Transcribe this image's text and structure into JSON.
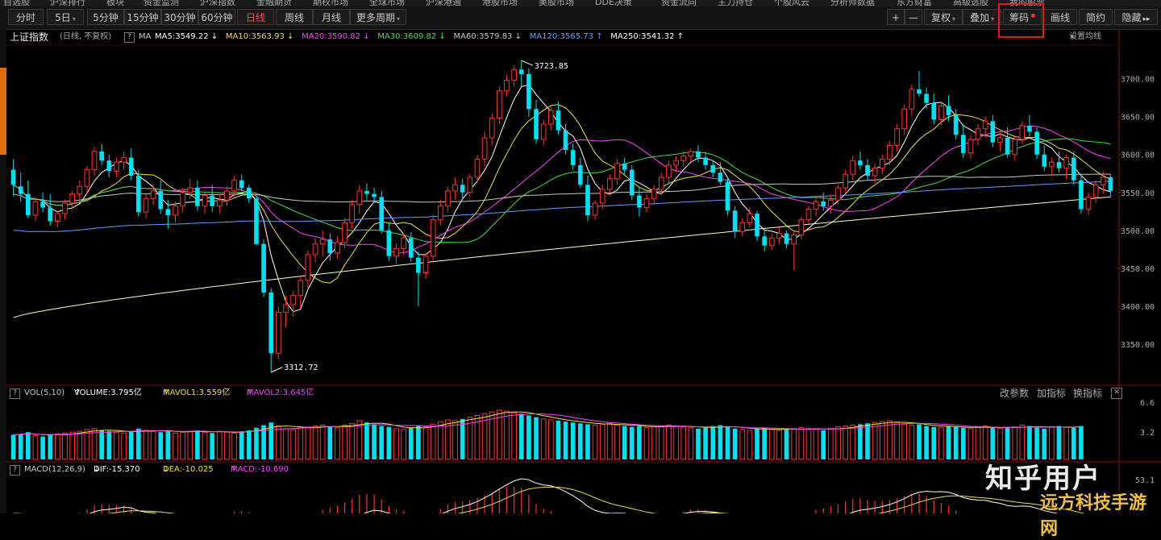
{
  "top_menu": [
    "自选股",
    "沪深排行",
    "板块",
    "资金监测",
    "沪深指数",
    "金融期货",
    "期权市场",
    "全球市场",
    "沪深港通",
    "港股市场",
    "美股市场",
    "DDE决策",
    "资金流向",
    "主力持仓",
    "个股风云",
    "分析师数据",
    "东方财富",
    "高级选股",
    "我的股票"
  ],
  "toolbar": {
    "periods": [
      "分时",
      "5日",
      "5分钟",
      "15分钟",
      "30分钟",
      "60分钟",
      "日线",
      "周线",
      "月线",
      "更多周期"
    ],
    "active_period": "日线",
    "more_caret": "▾",
    "zoom_in": "+",
    "zoom_out": "—",
    "restore": "复权",
    "overlay": "叠加",
    "chip": "筹码",
    "draw": "画线",
    "simple": "简约",
    "hide": "隐藏",
    "hide_arrows": "▸▸"
  },
  "info": {
    "title": "上证指数",
    "mode": "(日线, 不复权)",
    "help": "?",
    "ma_label": "MA",
    "ma": [
      {
        "text": "MA5:3549.22",
        "arrow": "↓",
        "color": "#ffffff"
      },
      {
        "text": "MA10:3563.93",
        "arrow": "↓",
        "color": "#f0e040"
      },
      {
        "text": "MA20:3590.82",
        "arrow": "↓",
        "color": "#ff40ff"
      },
      {
        "text": "MA30:3609.82",
        "arrow": "↓",
        "color": "#40e040"
      },
      {
        "text": "MA60:3579.83",
        "arrow": "↓",
        "color": "#c8c8c8"
      },
      {
        "text": "MA120:3565.73",
        "arrow": "↑",
        "color": "#60a0ff"
      },
      {
        "text": "MA250:3541.32",
        "arrow": "↑",
        "color": "#ffffff"
      }
    ],
    "settings": "设置均线",
    "settings_caret": "▾"
  },
  "price_axis": [
    "3700.00",
    "3650.00",
    "3600.00",
    "3550.00",
    "3500.00",
    "3450.00",
    "3400.00",
    "3350.00"
  ],
  "annotations": {
    "high": "3723.85",
    "low": "3312.72"
  },
  "vol": {
    "help": "?",
    "label": "VOL(5,10)",
    "volume": "VOLUME:3.795亿",
    "volume_arrow": "↑",
    "mavol1": "MAVOL1:3.559亿",
    "mavol1_arrow": "↑",
    "mavol2": "MAVOL2:3.645亿",
    "mavol2_arrow": "↑",
    "change_params": "改参数",
    "add_indicator": "加指标",
    "switch_indicator": "换指标",
    "close": "✕",
    "axis": [
      "6.6",
      "3.2"
    ]
  },
  "macd": {
    "help": "?",
    "label": "MACD(12,26,9)",
    "dif": "DIF:-15.370",
    "dif_arrow": "↓",
    "dea": "DEA:-10.025",
    "dea_arrow": "↓",
    "macd": "MACD:-10.690",
    "macd_arrow": "↑",
    "axis": [
      "53.1"
    ]
  },
  "watermark": {
    "main": "知乎用户",
    "site": "远方科技手游网"
  },
  "colors": {
    "up": "#ff3232",
    "down": "#00e0f0",
    "bg": "#000000"
  },
  "chart_data": {
    "type": "candlestick",
    "title": "上证指数",
    "ylim": [
      3300,
      3740
    ],
    "values": [
      [
        3580,
        3594,
        3545,
        3560
      ],
      [
        3558,
        3576,
        3538,
        3548
      ],
      [
        3548,
        3566,
        3516,
        3520
      ],
      [
        3520,
        3544,
        3512,
        3538
      ],
      [
        3538,
        3550,
        3524,
        3530
      ],
      [
        3530,
        3548,
        3506,
        3512
      ],
      [
        3512,
        3526,
        3504,
        3522
      ],
      [
        3522,
        3540,
        3514,
        3536
      ],
      [
        3536,
        3552,
        3528,
        3548
      ],
      [
        3548,
        3566,
        3538,
        3558
      ],
      [
        3558,
        3585,
        3548,
        3580
      ],
      [
        3580,
        3610,
        3572,
        3604
      ],
      [
        3604,
        3614,
        3586,
        3592
      ],
      [
        3592,
        3600,
        3570,
        3578
      ],
      [
        3578,
        3596,
        3570,
        3590
      ],
      [
        3590,
        3604,
        3580,
        3596
      ],
      [
        3596,
        3608,
        3566,
        3572
      ],
      [
        3572,
        3580,
        3518,
        3524
      ],
      [
        3524,
        3548,
        3516,
        3542
      ],
      [
        3542,
        3560,
        3534,
        3552
      ],
      [
        3552,
        3566,
        3522,
        3528
      ],
      [
        3528,
        3540,
        3502,
        3520
      ],
      [
        3520,
        3538,
        3510,
        3532
      ],
      [
        3532,
        3556,
        3524,
        3550
      ],
      [
        3550,
        3568,
        3542,
        3556
      ],
      [
        3556,
        3566,
        3526,
        3532
      ],
      [
        3532,
        3550,
        3522,
        3546
      ],
      [
        3546,
        3560,
        3524,
        3532
      ],
      [
        3532,
        3548,
        3522,
        3540
      ],
      [
        3540,
        3558,
        3532,
        3552
      ],
      [
        3552,
        3572,
        3544,
        3566
      ],
      [
        3566,
        3574,
        3552,
        3556
      ],
      [
        3556,
        3560,
        3536,
        3542
      ],
      [
        3542,
        3546,
        3480,
        3482
      ],
      [
        3482,
        3488,
        3412,
        3418
      ],
      [
        3418,
        3424,
        3313,
        3338
      ],
      [
        3338,
        3400,
        3330,
        3392
      ],
      [
        3392,
        3414,
        3372,
        3402
      ],
      [
        3402,
        3420,
        3386,
        3414
      ],
      [
        3414,
        3440,
        3398,
        3434
      ],
      [
        3434,
        3474,
        3424,
        3468
      ],
      [
        3468,
        3490,
        3458,
        3482
      ],
      [
        3482,
        3500,
        3466,
        3488
      ],
      [
        3488,
        3496,
        3460,
        3470
      ],
      [
        3470,
        3492,
        3462,
        3484
      ],
      [
        3484,
        3516,
        3476,
        3510
      ],
      [
        3510,
        3540,
        3502,
        3534
      ],
      [
        3534,
        3560,
        3522,
        3552
      ],
      [
        3552,
        3562,
        3538,
        3548
      ],
      [
        3548,
        3556,
        3536,
        3544
      ],
      [
        3544,
        3552,
        3496,
        3500
      ],
      [
        3500,
        3510,
        3460,
        3466
      ],
      [
        3466,
        3482,
        3456,
        3476
      ],
      [
        3476,
        3496,
        3468,
        3490
      ],
      [
        3490,
        3498,
        3458,
        3464
      ],
      [
        3464,
        3472,
        3400,
        3444
      ],
      [
        3444,
        3470,
        3436,
        3466
      ],
      [
        3466,
        3520,
        3460,
        3514
      ],
      [
        3514,
        3540,
        3506,
        3532
      ],
      [
        3532,
        3558,
        3524,
        3552
      ],
      [
        3552,
        3570,
        3540,
        3560
      ],
      [
        3560,
        3568,
        3540,
        3550
      ],
      [
        3550,
        3574,
        3544,
        3570
      ],
      [
        3570,
        3600,
        3562,
        3594
      ],
      [
        3594,
        3630,
        3584,
        3622
      ],
      [
        3622,
        3654,
        3612,
        3648
      ],
      [
        3648,
        3690,
        3640,
        3684
      ],
      [
        3684,
        3705,
        3676,
        3698
      ],
      [
        3698,
        3718,
        3690,
        3712
      ],
      [
        3712,
        3724,
        3690,
        3706
      ],
      [
        3706,
        3714,
        3650,
        3660
      ],
      [
        3660,
        3672,
        3614,
        3620
      ],
      [
        3620,
        3646,
        3612,
        3640
      ],
      [
        3640,
        3664,
        3632,
        3658
      ],
      [
        3658,
        3670,
        3626,
        3632
      ],
      [
        3632,
        3640,
        3600,
        3606
      ],
      [
        3606,
        3614,
        3580,
        3586
      ],
      [
        3586,
        3596,
        3556,
        3560
      ],
      [
        3560,
        3572,
        3512,
        3520
      ],
      [
        3520,
        3540,
        3514,
        3536
      ],
      [
        3536,
        3560,
        3528,
        3554
      ],
      [
        3554,
        3574,
        3546,
        3568
      ],
      [
        3568,
        3594,
        3560,
        3588
      ],
      [
        3588,
        3596,
        3574,
        3580
      ],
      [
        3580,
        3586,
        3540,
        3546
      ],
      [
        3546,
        3556,
        3518,
        3530
      ],
      [
        3530,
        3548,
        3524,
        3542
      ],
      [
        3542,
        3560,
        3534,
        3554
      ],
      [
        3554,
        3576,
        3546,
        3570
      ],
      [
        3570,
        3592,
        3562,
        3586
      ],
      [
        3586,
        3598,
        3576,
        3592
      ],
      [
        3592,
        3604,
        3584,
        3598
      ],
      [
        3598,
        3608,
        3590,
        3604
      ],
      [
        3604,
        3612,
        3590,
        3596
      ],
      [
        3596,
        3604,
        3580,
        3586
      ],
      [
        3586,
        3592,
        3570,
        3576
      ],
      [
        3576,
        3590,
        3560,
        3564
      ],
      [
        3564,
        3570,
        3520,
        3526
      ],
      [
        3526,
        3532,
        3490,
        3498
      ],
      [
        3498,
        3516,
        3492,
        3510
      ],
      [
        3510,
        3530,
        3504,
        3522
      ],
      [
        3522,
        3526,
        3486,
        3492
      ],
      [
        3492,
        3500,
        3472,
        3480
      ],
      [
        3480,
        3496,
        3474,
        3490
      ],
      [
        3490,
        3504,
        3482,
        3496
      ],
      [
        3496,
        3500,
        3476,
        3482
      ],
      [
        3482,
        3498,
        3448,
        3494
      ],
      [
        3494,
        3518,
        3488,
        3514
      ],
      [
        3514,
        3532,
        3508,
        3528
      ],
      [
        3528,
        3544,
        3518,
        3538
      ],
      [
        3538,
        3550,
        3526,
        3532
      ],
      [
        3532,
        3546,
        3522,
        3540
      ],
      [
        3540,
        3560,
        3534,
        3556
      ],
      [
        3556,
        3580,
        3548,
        3574
      ],
      [
        3574,
        3598,
        3566,
        3592
      ],
      [
        3592,
        3604,
        3580,
        3586
      ],
      [
        3586,
        3594,
        3566,
        3572
      ],
      [
        3572,
        3588,
        3562,
        3582
      ],
      [
        3582,
        3600,
        3574,
        3594
      ],
      [
        3594,
        3618,
        3586,
        3612
      ],
      [
        3612,
        3640,
        3604,
        3634
      ],
      [
        3634,
        3666,
        3626,
        3660
      ],
      [
        3660,
        3692,
        3652,
        3686
      ],
      [
        3686,
        3710,
        3676,
        3680
      ],
      [
        3680,
        3688,
        3660,
        3668
      ],
      [
        3668,
        3680,
        3640,
        3646
      ],
      [
        3646,
        3670,
        3638,
        3664
      ],
      [
        3664,
        3678,
        3644,
        3652
      ],
      [
        3652,
        3660,
        3620,
        3626
      ],
      [
        3626,
        3640,
        3596,
        3602
      ],
      [
        3602,
        3626,
        3594,
        3620
      ],
      [
        3620,
        3640,
        3612,
        3634
      ],
      [
        3634,
        3650,
        3622,
        3644
      ],
      [
        3644,
        3652,
        3610,
        3616
      ],
      [
        3616,
        3630,
        3604,
        3622
      ],
      [
        3622,
        3636,
        3596,
        3600
      ],
      [
        3600,
        3626,
        3592,
        3620
      ],
      [
        3620,
        3644,
        3614,
        3638
      ],
      [
        3638,
        3652,
        3624,
        3630
      ],
      [
        3630,
        3636,
        3594,
        3600
      ],
      [
        3600,
        3612,
        3578,
        3584
      ],
      [
        3584,
        3596,
        3572,
        3590
      ],
      [
        3590,
        3604,
        3576,
        3582
      ],
      [
        3582,
        3600,
        3568,
        3596
      ],
      [
        3596,
        3604,
        3560,
        3566
      ],
      [
        3566,
        3572,
        3522,
        3528
      ],
      [
        3528,
        3550,
        3520,
        3544
      ],
      [
        3544,
        3566,
        3536,
        3560
      ],
      [
        3560,
        3578,
        3548,
        3570
      ],
      [
        3570,
        3574,
        3544,
        3552
      ]
    ],
    "ma_lines": [
      "MA5",
      "MA10",
      "MA20",
      "MA30",
      "MA60",
      "MA120",
      "MA250"
    ],
    "volume": [
      2.8,
      2.9,
      3.1,
      2.7,
      2.6,
      2.8,
      2.9,
      3.0,
      3.1,
      3.2,
      3.4,
      3.5,
      3.3,
      3.2,
      3.1,
      3.0,
      3.2,
      3.5,
      3.3,
      3.2,
      3.1,
      3.3,
      3.0,
      3.1,
      3.2,
      3.3,
      3.1,
      3.0,
      3.2,
      3.1,
      3.0,
      3.2,
      3.3,
      3.6,
      3.9,
      4.2,
      3.8,
      3.5,
      3.4,
      3.6,
      3.7,
      3.8,
      3.9,
      3.7,
      3.6,
      3.9,
      4.1,
      4.4,
      4.2,
      4.0,
      3.8,
      3.7,
      3.5,
      3.4,
      3.6,
      3.8,
      3.7,
      4.0,
      4.3,
      4.5,
      4.4,
      4.6,
      4.8,
      5.0,
      5.2,
      5.4,
      5.6,
      5.5,
      5.3,
      5.2,
      5.0,
      4.8,
      4.6,
      4.5,
      4.4,
      4.3,
      4.2,
      4.1,
      4.0,
      3.9,
      4.0,
      4.1,
      3.9,
      3.8,
      3.7,
      3.8,
      3.6,
      3.7,
      3.8,
      3.9,
      3.8,
      3.7,
      3.6,
      3.5,
      3.6,
      3.8,
      3.9,
      3.7,
      3.5,
      3.4,
      3.3,
      3.5,
      3.6,
      3.4,
      3.3,
      3.4,
      3.5,
      3.6,
      3.5,
      3.4,
      3.3,
      3.5,
      3.7,
      3.8,
      3.9,
      4.0,
      4.1,
      4.2,
      4.3,
      4.4,
      4.2,
      4.0,
      3.9,
      4.0,
      3.8,
      3.7,
      3.6,
      3.8,
      3.7,
      3.6,
      3.5,
      3.7,
      3.8,
      3.6,
      3.5,
      3.6,
      3.7,
      3.9,
      3.8,
      3.6,
      3.5,
      3.7,
      3.8,
      3.7,
      3.6,
      3.8
    ]
  }
}
